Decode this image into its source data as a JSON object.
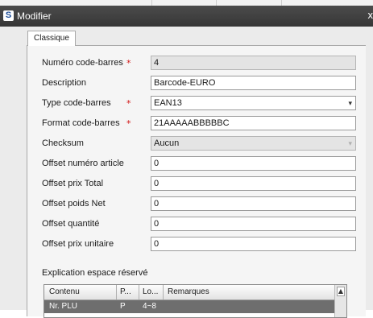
{
  "window": {
    "title": "Modifier",
    "close_glyph": "x",
    "app_icon_letter": "S"
  },
  "tabs": [
    {
      "label": "Classique",
      "active": true
    }
  ],
  "form": {
    "fields": [
      {
        "label": "Numéro code-barres",
        "required": true,
        "value": "4",
        "type": "readonly"
      },
      {
        "label": "Description",
        "required": false,
        "value": "Barcode-EURO",
        "type": "text"
      },
      {
        "label": "Type code-barres",
        "required": true,
        "value": "EAN13",
        "type": "select"
      },
      {
        "label": "Format code-barres",
        "required": true,
        "value": "21AAAAABBBBBC",
        "type": "text"
      },
      {
        "label": "Checksum",
        "required": false,
        "value": "Aucun",
        "type": "select-disabled"
      },
      {
        "label": "Offset numéro article",
        "required": false,
        "value": "0",
        "type": "text"
      },
      {
        "label": "Offset prix Total",
        "required": false,
        "value": "0",
        "type": "text"
      },
      {
        "label": "Offset poids Net",
        "required": false,
        "value": "0",
        "type": "text"
      },
      {
        "label": "Offset quantité",
        "required": false,
        "value": "0",
        "type": "text"
      },
      {
        "label": "Offset prix unitaire",
        "required": false,
        "value": "0",
        "type": "text"
      }
    ],
    "required_mark": "*"
  },
  "reserved": {
    "title": "Explication espace réservé",
    "columns": [
      "Contenu",
      "P...",
      "Lo...",
      "Remarques"
    ],
    "rows": [
      [
        "Nr. PLU",
        "P",
        "4~8",
        ""
      ]
    ]
  },
  "icons": {
    "app": "app-logo-icon",
    "close": "close-icon",
    "dropdown": "chevron-down-icon",
    "scroll_up": "scroll-up-icon"
  },
  "colors": {
    "titlebar": "#3e3e3e",
    "required": "#d21a1a",
    "selected_row": "#6e6e6e"
  }
}
